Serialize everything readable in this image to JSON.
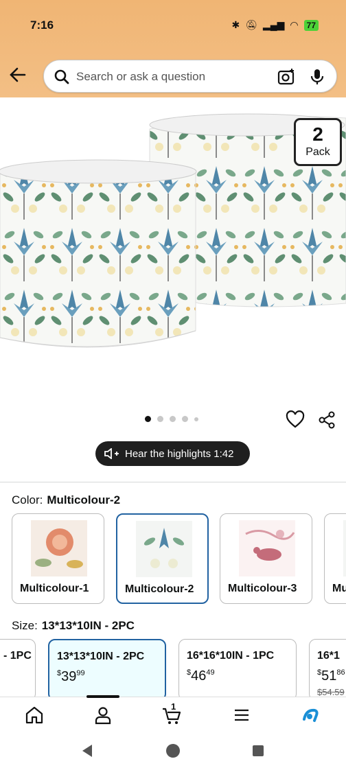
{
  "status_bar": {
    "time": "7:16",
    "battery": "77"
  },
  "search": {
    "placeholder": "Search or ask a question"
  },
  "product": {
    "pack_badge": {
      "number": "2",
      "label": "Pack"
    },
    "image_count": 5,
    "highlights_label": "Hear the highlights 1:42"
  },
  "color": {
    "label": "Color:",
    "selected": "Multicolour-2",
    "options": [
      {
        "label": "Multicolour-1"
      },
      {
        "label": "Multicolour-2"
      },
      {
        "label": "Multicolour-3"
      },
      {
        "label": "Mu"
      }
    ]
  },
  "size": {
    "label": "Size:",
    "selected": "13*13*10IN - 2PC",
    "options": [
      {
        "name": "- 1PC",
        "price_whole": "",
        "price_frac": ""
      },
      {
        "name": "13*13*10IN - 2PC",
        "price_whole": "$39",
        "price_frac": "99"
      },
      {
        "name": "16*16*10IN - 1PC",
        "price_whole": "$46",
        "price_frac": "49"
      },
      {
        "name": "16*1",
        "price_whole": "$51",
        "price_frac": "86",
        "was": "$54.59"
      }
    ]
  },
  "bottom_nav": {
    "cart_count": "1"
  },
  "colors": {
    "header": "#f0b574",
    "selected_border": "#2162a1"
  }
}
